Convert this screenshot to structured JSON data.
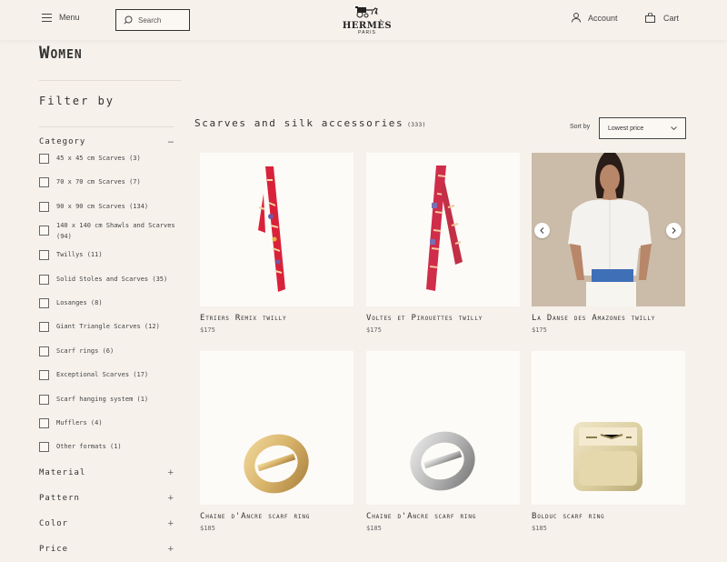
{
  "header": {
    "menu_label": "Menu",
    "search_placeholder": "Search",
    "brand": "HERMÈS",
    "brand_city": "PARIS",
    "account_label": "Account",
    "cart_label": "Cart"
  },
  "sidebar": {
    "page_title": "Women",
    "filter_title": "Filter by",
    "category_label": "Category",
    "category_toggle": "–",
    "categories": [
      "45 x 45 cm Scarves (3)",
      "70 x 70 cm Scarves (7)",
      "90 x 90 cm Scarves (134)",
      "140 x 140 cm Shawls and Scarves (94)",
      "Twillys (11)",
      "Solid Stoles and Scarves (35)",
      "Losanges (8)",
      "Giant Triangle Scarves (12)",
      "Scarf rings (6)",
      "Exceptional Scarves (17)",
      "Scarf hanging system (1)",
      "Mufflers (4)",
      "Other formats (1)"
    ],
    "facets": [
      "Material",
      "Pattern",
      "Color",
      "Price"
    ],
    "facet_toggle": "+"
  },
  "main": {
    "section_title": "Scarves and silk accessories",
    "section_count": "(333)",
    "sort_label": "Sort by",
    "sort_value": "Lowest price",
    "products": [
      {
        "name": "Etriers Remix twilly",
        "price": "$175"
      },
      {
        "name": "Voltes et Pirouettes twilly",
        "price": "$175"
      },
      {
        "name": "La Danse des Amazones twilly",
        "price": "$175"
      },
      {
        "name": "Chaine d'Ancre scarf ring",
        "price": "$185"
      },
      {
        "name": "Chaine d'Ancre scarf ring",
        "price": "$185"
      },
      {
        "name": "Bolduc scarf ring",
        "price": "$185"
      }
    ]
  },
  "colors": {
    "background": "#f6f1eb",
    "card_bg": "#fdfbf7",
    "twilly_red": "#d9223a",
    "gold": "#d8b36a",
    "silver": "#c8c8c8"
  }
}
